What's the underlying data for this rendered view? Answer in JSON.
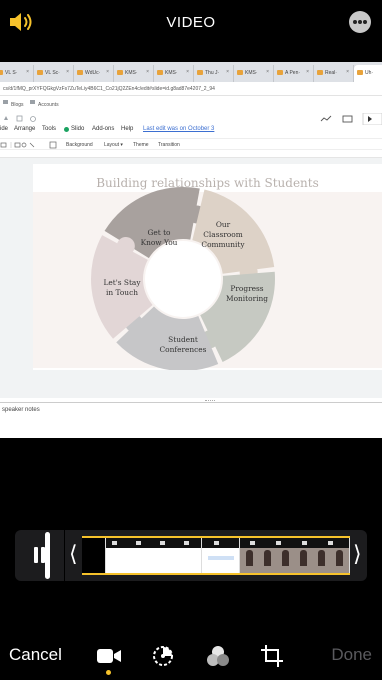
{
  "header": {
    "title": "VIDEO",
    "audio_icon": "speaker-wave-icon",
    "more_icon": "ellipsis-circle-icon"
  },
  "browser": {
    "tabs": [
      "VL S·",
      "VL Sc·",
      "WdUc·",
      "KMS·",
      "KMS·",
      "Thu J·",
      "KMS·",
      "A Pen·",
      "Real·",
      "Uh·"
    ],
    "url": "cs/d/1fMQ_prXYFQGkgVzFs7ZuTeLiy4B6C1_Co21jQ2ZEn4c/edit#slide=id.g8ad87e4207_2_94",
    "bookmarks": [
      "Blogs",
      "Accounts"
    ],
    "menu": [
      "ide",
      "Arrange",
      "Tools",
      "Slido",
      "Add-ons",
      "Help"
    ],
    "last_edit": "Last edit was on October 3",
    "toolbar": [
      "Background",
      "Layout ▾",
      "Theme",
      "Transition"
    ]
  },
  "slide": {
    "title": "Building relationships with Students",
    "segments": [
      {
        "line1": "Get to",
        "line2": "Know You",
        "line3": ""
      },
      {
        "line1": "Our",
        "line2": "Classroom",
        "line3": "Community"
      },
      {
        "line1": "Progress",
        "line2": "Monitoring",
        "line3": ""
      },
      {
        "line1": "Student",
        "line2": "Conferences",
        "line3": ""
      },
      {
        "line1": "Let's Stay",
        "line2": "in Touch",
        "line3": ""
      }
    ],
    "segment_colors": [
      "#a8a19e",
      "#ddd2c7",
      "#c6c9c2",
      "#c6c6c8",
      "#e2d6d6"
    ]
  },
  "notes": {
    "label": "speaker notes"
  },
  "timeline": {
    "pause_icon": "pause-icon",
    "trim_start_icon": "chevron-left-icon",
    "trim_end_icon": "chevron-right-icon",
    "trim_start_glyph": "⟨",
    "trim_end_glyph": "⟩",
    "accent": "#f6c22b"
  },
  "footer": {
    "cancel": "Cancel",
    "done": "Done",
    "tools": [
      "video-camera-icon",
      "adjust-dial-icon",
      "filters-icon",
      "crop-rotate-icon"
    ]
  }
}
